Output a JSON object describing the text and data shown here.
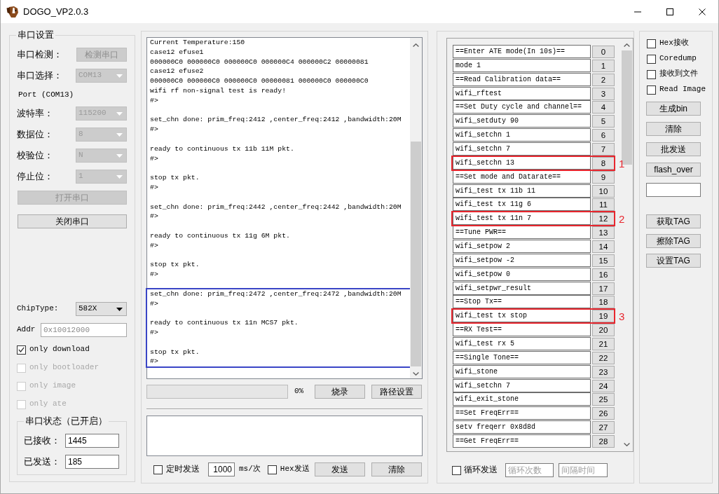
{
  "window": {
    "title": "DOGO_VP2.0.3"
  },
  "serial_settings": {
    "title": "串口设置",
    "detect": {
      "label": "串口检测：",
      "button": "检测串口",
      "disabled": true
    },
    "port_select": {
      "label": "串口选择：",
      "value": "COM13",
      "disabled": true
    },
    "port_info": "Port (COM13)",
    "params": [
      {
        "label": "波特率：",
        "value": "115200",
        "disabled": true
      },
      {
        "label": "数据位：",
        "value": "8",
        "disabled": true
      },
      {
        "label": "校验位：",
        "value": "N",
        "disabled": true
      },
      {
        "label": "停止位：",
        "value": "1",
        "disabled": true
      }
    ],
    "buttons": [
      {
        "label": "打开串口",
        "disabled": true
      },
      {
        "label": "关闭串口",
        "disabled": false
      }
    ],
    "chip_type": {
      "label": "ChipType:",
      "value": "582X",
      "disabled": false
    },
    "addr": {
      "label": "Addr",
      "value": "0x10012000",
      "disabled": true
    },
    "options": [
      {
        "label": "only download",
        "checked": true,
        "disabled": false
      },
      {
        "label": "only bootloader",
        "checked": false,
        "disabled": true
      },
      {
        "label": "only image",
        "checked": false,
        "disabled": true
      },
      {
        "label": "only ate",
        "checked": false,
        "disabled": true
      }
    ],
    "status": {
      "title": "串口状态（已开启）",
      "counters": [
        {
          "label": "已接收：",
          "value": "1445"
        },
        {
          "label": "已发送：",
          "value": "185"
        }
      ]
    }
  },
  "log": [
    {
      "boxed": false,
      "paragraphs": [
        [
          "Current Temperature:150",
          "case12 efuse1",
          "000000C0 000000C0 000000C0 000000C4 000000C2 00000081",
          "case12 efuse2",
          "000000C0 000000C0 000000C0 00000081 000000C0 000000C0",
          "wifi rf non-signal test is ready!",
          "#>"
        ],
        [
          "set_chn done: prim_freq:2412 ,center_freq:2412 ,bandwidth:20M",
          "#>"
        ],
        [
          "ready to continuous tx 11b 11M pkt.",
          "#>"
        ],
        [
          "stop tx pkt.",
          "#>"
        ],
        [
          "set_chn done: prim_freq:2442 ,center_freq:2442 ,bandwidth:20M",
          "#>"
        ],
        [
          "ready to continuous tx 11g 6M pkt.",
          "#>"
        ],
        [
          "stop tx pkt.",
          "#>"
        ]
      ]
    },
    {
      "boxed": true,
      "paragraphs": [
        [
          "set_chn done: prim_freq:2472 ,center_freq:2472 ,bandwidth:20M",
          "#>"
        ],
        [
          "ready to continuous tx 11n MCS7 pkt.",
          "#>"
        ],
        [
          "stop tx pkt.",
          "#>"
        ]
      ]
    }
  ],
  "burn": {
    "level": 0,
    "reading": "0%",
    "buttons": [
      "烧录",
      "路径设置"
    ]
  },
  "send": {
    "timed_send": {
      "label": "定时发送",
      "checked": false
    },
    "interval": "1000",
    "unit": "ms/次",
    "hex_send": {
      "label": "Hex发送",
      "checked": false
    },
    "buttons": [
      "发送",
      "清除"
    ]
  },
  "commands": [
    {
      "label": "==Enter ATE mode(In 10s)==",
      "number": "0"
    },
    {
      "label": "mode 1",
      "number": "1"
    },
    {
      "label": "==Read Calibration data==",
      "number": "2"
    },
    {
      "label": "wifi_rftest",
      "number": "3"
    },
    {
      "label": "==Set Duty cycle and channel==",
      "number": "4"
    },
    {
      "label": "wifi_setduty 90",
      "number": "5"
    },
    {
      "label": "wifi_setchn 1",
      "number": "6"
    },
    {
      "label": "wifi_setchn 7",
      "number": "7"
    },
    {
      "label": "wifi_setchn 13",
      "number": "8",
      "annotation": "1"
    },
    {
      "label": "==Set mode and Datarate==",
      "number": "9"
    },
    {
      "label": "wifi_test tx 11b 11",
      "number": "10"
    },
    {
      "label": "wifi_test tx 11g 6",
      "number": "11"
    },
    {
      "label": "wifi_test tx 11n 7",
      "number": "12",
      "annotation": "2"
    },
    {
      "label": "==Tune PWR==",
      "number": "13"
    },
    {
      "label": "wifi_setpow 2",
      "number": "14"
    },
    {
      "label": "wifi_setpow -2",
      "number": "15"
    },
    {
      "label": "wifi_setpow 0",
      "number": "16"
    },
    {
      "label": "wifi_setpwr_result",
      "number": "17"
    },
    {
      "label": "==Stop Tx==",
      "number": "18"
    },
    {
      "label": "wifi_test tx stop",
      "number": "19",
      "annotation": "3"
    },
    {
      "label": "==RX Test==",
      "number": "20"
    },
    {
      "label": "wifi_test rx 5",
      "number": "21"
    },
    {
      "label": "==Single Tone==",
      "number": "22"
    },
    {
      "label": "wifi_stone",
      "number": "23"
    },
    {
      "label": "wifi_setchn 7",
      "number": "24"
    },
    {
      "label": "wifi_exit_stone",
      "number": "25"
    },
    {
      "label": "==Set FreqErr==",
      "number": "26"
    },
    {
      "label": "setv freqerr 0x8d8d",
      "number": "27"
    },
    {
      "label": "==Get FreqErr==",
      "number": "28"
    }
  ],
  "loop_send": {
    "label": "循环发送",
    "checked": false,
    "fields": [
      {
        "placeholder": "循环次数"
      },
      {
        "placeholder": "间隔时间"
      }
    ]
  },
  "options_panel": {
    "checkboxes": [
      {
        "label": "Hex接收",
        "checked": false
      },
      {
        "label": "Coredump",
        "checked": false
      },
      {
        "label": "接收到文件",
        "checked": false
      },
      {
        "label": "Read Image",
        "checked": false
      }
    ],
    "tools": [
      {
        "kind": "button",
        "label": "生成bin"
      },
      {
        "kind": "button",
        "label": "清除"
      },
      {
        "kind": "button",
        "label": "批发送"
      },
      {
        "kind": "button",
        "label": "flash_over"
      },
      {
        "kind": "input"
      }
    ],
    "tag_buttons": [
      "获取TAG",
      "擦除TAG",
      "设置TAG"
    ]
  }
}
